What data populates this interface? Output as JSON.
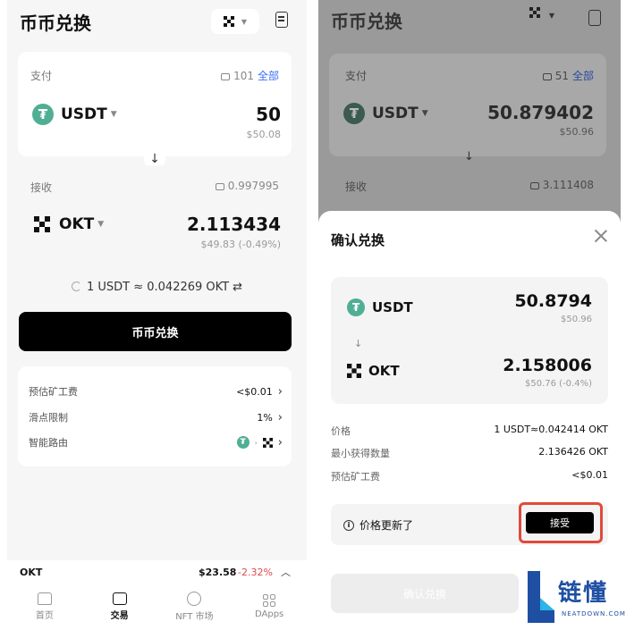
{
  "left": {
    "title": "币币兑换",
    "pay": {
      "label": "支付",
      "balance": "101",
      "all": "全部",
      "token": "USDT",
      "amount": "50",
      "fiat": "$50.08"
    },
    "receive": {
      "label": "接收",
      "balance": "0.997995",
      "token": "OKT",
      "amount": "2.113434",
      "fiat": "$49.83 (-0.49%)"
    },
    "rate": "1 USDT ≈ 0.042269 OKT",
    "swap_button": "币币兑换",
    "info": [
      {
        "label": "预估矿工费",
        "value": "<$0.01"
      },
      {
        "label": "滑点限制",
        "value": "1%"
      },
      {
        "label": "智能路由",
        "value": ""
      }
    ],
    "ticker": {
      "symbol": "OKT",
      "price": "$23.58",
      "change": "-2.32%"
    },
    "tabs": [
      {
        "label": "首页",
        "icon": "home-icon"
      },
      {
        "label": "交易",
        "icon": "trade-icon"
      },
      {
        "label": "NFT 市场",
        "icon": "nft-icon"
      },
      {
        "label": "DApps",
        "icon": "grid-icon"
      }
    ]
  },
  "right": {
    "title": "币币兑换",
    "pay": {
      "label": "支付",
      "balance": "51",
      "all": "全部",
      "token": "USDT",
      "amount": "50.879402",
      "fiat": "$50.96"
    },
    "receive": {
      "label": "接收",
      "balance": "3.111408"
    },
    "sheet": {
      "title": "确认兑换",
      "from_token": "USDT",
      "from_amount": "50.8794",
      "from_fiat": "$50.96",
      "to_token": "OKT",
      "to_amount": "2.158006",
      "to_fiat": "$50.76 (-0.4%)",
      "details": [
        {
          "label": "价格",
          "value": "1 USDT≈0.042414 OKT"
        },
        {
          "label": "最小获得数量",
          "value": "2.136426 OKT"
        },
        {
          "label": "预估矿工费",
          "value": "<$0.01"
        }
      ],
      "price_updated": "价格更新了",
      "accept": "接受",
      "confirm": "确认兑换"
    }
  },
  "watermark": {
    "text": "链懂",
    "sub": "NEATDOWN.COM"
  },
  "colors": {
    "tether": "#50ae94",
    "link": "#3b6ef5",
    "negative": "#e0474f",
    "highlight": "#e14a3b"
  }
}
